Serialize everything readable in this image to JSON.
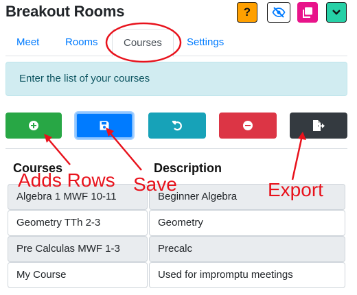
{
  "app": {
    "title": "Breakout Rooms"
  },
  "top_icons": {
    "help_label": "?",
    "icons": [
      "eye-slash-icon",
      "copy-icon",
      "chevron-down-icon"
    ],
    "colors": {
      "help": "#ffa000",
      "copy": "#e8148a",
      "menu": "#26d0a6"
    }
  },
  "tabs": [
    {
      "label": "Meet",
      "active": false
    },
    {
      "label": "Rooms",
      "active": false
    },
    {
      "label": "Courses",
      "active": true
    },
    {
      "label": "Settings",
      "active": false
    }
  ],
  "info": {
    "text": "Enter the list of your courses"
  },
  "actions": [
    {
      "icon": "plus-circle-icon",
      "color": "#28a745"
    },
    {
      "icon": "save-icon",
      "color": "#007bff"
    },
    {
      "icon": "undo-icon",
      "color": "#17a2b8"
    },
    {
      "icon": "minus-circle-icon",
      "color": "#dc3545"
    },
    {
      "icon": "file-export-icon",
      "color": "#343a40"
    }
  ],
  "table": {
    "headers": [
      "Courses",
      "Description"
    ],
    "rows": [
      {
        "course": "Algebra 1 MWF 10-11",
        "description": "Beginner Algebra"
      },
      {
        "course": "Geometry TTh 2-3",
        "description": "Geometry"
      },
      {
        "course": "Pre Calculas MWF 1-3",
        "description": "Precalc"
      },
      {
        "course": "My Course",
        "description": "Used for impromptu meetings"
      }
    ]
  },
  "annotations": {
    "adds_rows": "Adds Rows",
    "save": "Save",
    "export": "Export",
    "color": "#e8121c"
  }
}
